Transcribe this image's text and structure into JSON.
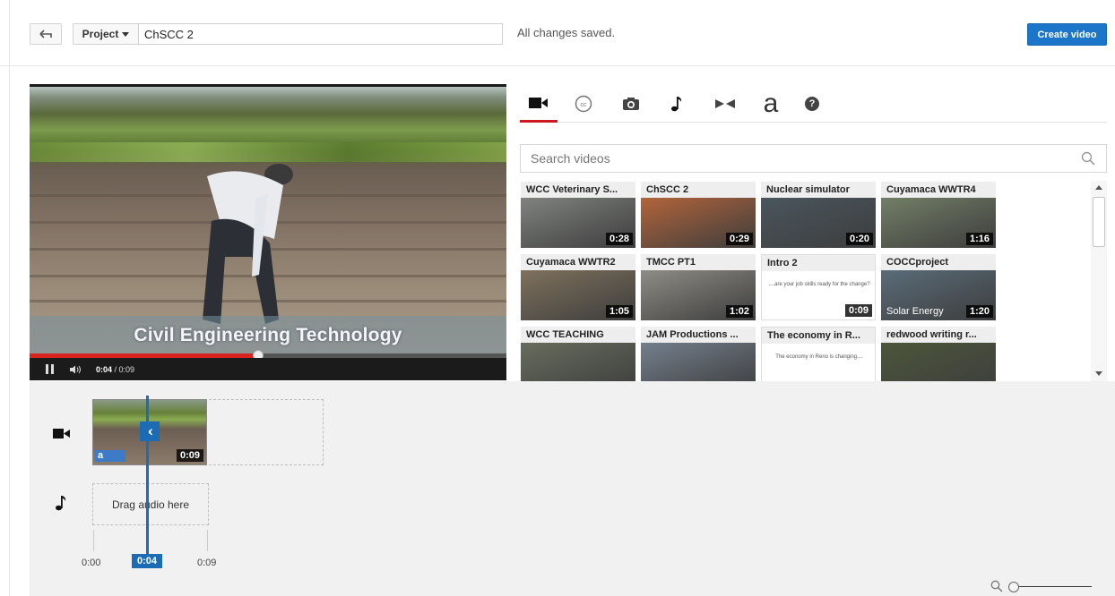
{
  "topbar": {
    "project_label": "Project",
    "title_value": "ChSCC 2",
    "status": "All changes saved.",
    "create_label": "Create video"
  },
  "player": {
    "caption": "Civil Engineering Technology",
    "time_current": "0:04",
    "time_total": "/ 0:09",
    "progress_fraction": 0.48
  },
  "tabs": [
    {
      "icon": "video-camera-icon",
      "active": true
    },
    {
      "icon": "closed-caption-icon",
      "active": false
    },
    {
      "icon": "camera-icon",
      "active": false
    },
    {
      "icon": "music-note-icon",
      "active": false
    },
    {
      "icon": "transitions-icon",
      "active": false
    },
    {
      "icon": "text-icon",
      "glyph": "a",
      "active": false
    },
    {
      "icon": "help-icon",
      "glyph": "?",
      "active": false
    }
  ],
  "search": {
    "placeholder": "Search videos"
  },
  "videos": [
    {
      "title": "WCC Veterinary S...",
      "duration": "0:28",
      "color": "#8b8f8a"
    },
    {
      "title": "ChSCC 2",
      "duration": "0:29",
      "color": "#c76b3a"
    },
    {
      "title": "Nuclear simulator",
      "duration": "0:20",
      "color": "#4c5a63"
    },
    {
      "title": "Cuyamaca WWTR4",
      "duration": "1:16",
      "color": "#7c8a6e"
    },
    {
      "title": "Cuyamaca WWTR2",
      "duration": "1:05",
      "color": "#8a7a62"
    },
    {
      "title": "TMCC PT1",
      "duration": "1:02",
      "color": "#9c9a92"
    },
    {
      "title": "Intro 2",
      "duration": "0:09",
      "color": "#ffffff",
      "subtitle": "....are your job skills ready for the change?"
    },
    {
      "title": "COCCproject",
      "duration": "1:20",
      "color": "#5f7483",
      "overlay": "Solar Energy"
    },
    {
      "title": "WCC TEACHING",
      "duration": "",
      "color": "#6e7563"
    },
    {
      "title": "JAM Productions ...",
      "duration": "",
      "color": "#7d8a9a"
    },
    {
      "title": "The economy in R...",
      "duration": "",
      "color": "#ffffff",
      "subtitle": "The economy in Reno is changing...."
    },
    {
      "title": "redwood writing r...",
      "duration": "",
      "color": "#4f5a3a"
    }
  ],
  "timeline": {
    "clip_duration": "0:09",
    "clip_badge": "a",
    "remove_label": "x",
    "audio_placeholder": "Drag audio here",
    "start_label": "0:00",
    "end_label": "0:09",
    "playhead_label": "0:04"
  }
}
